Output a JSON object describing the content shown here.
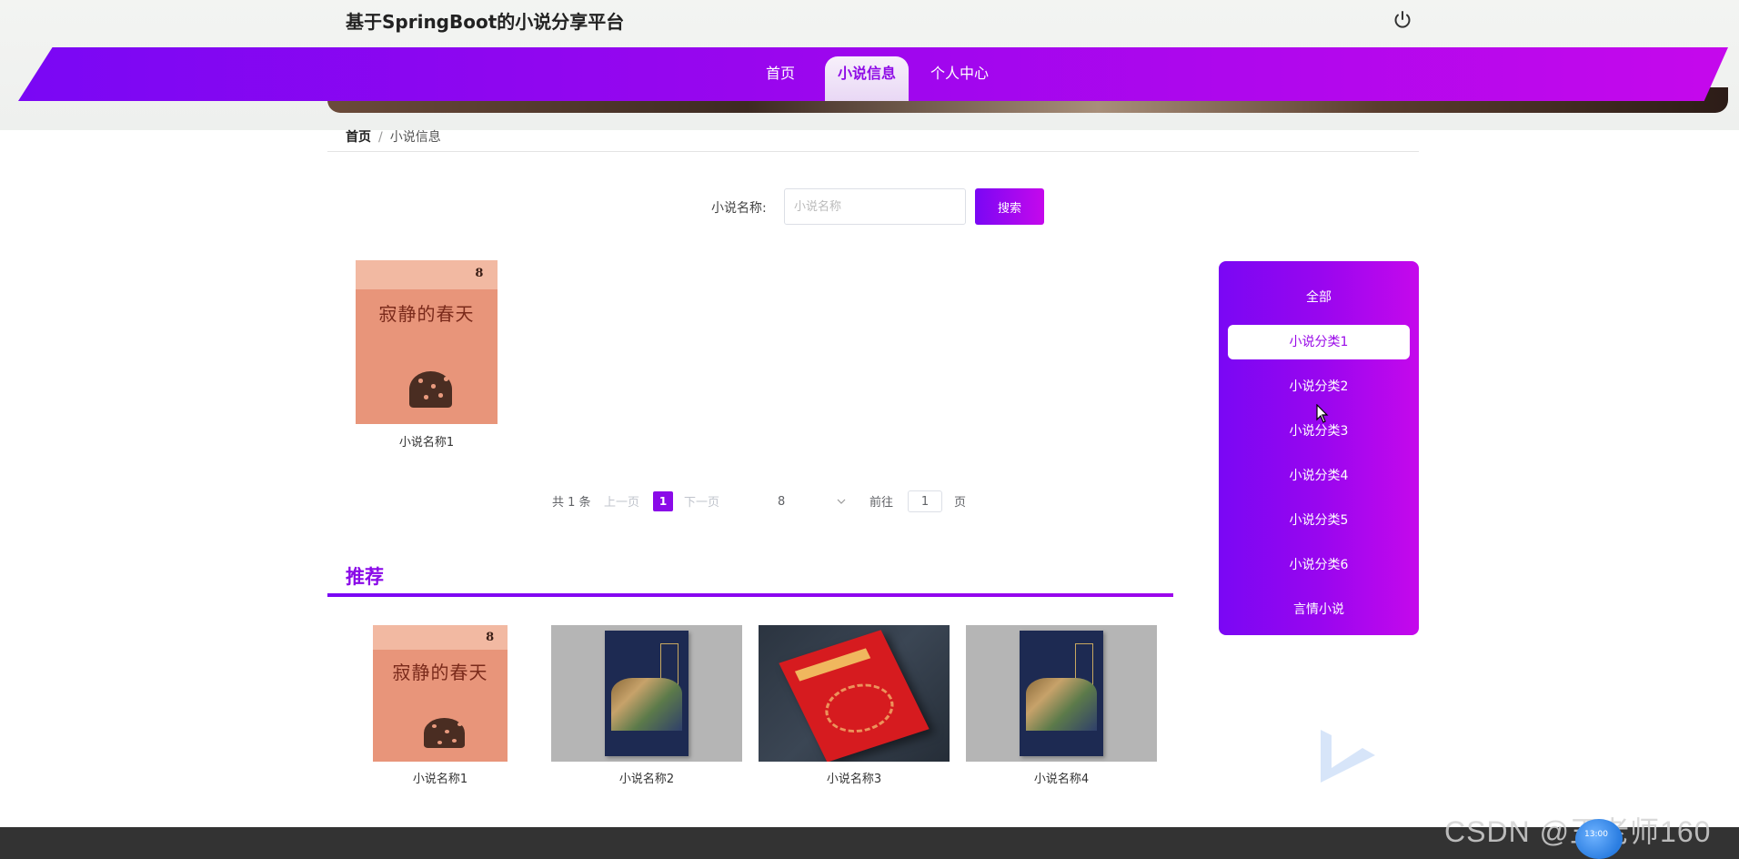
{
  "header": {
    "site_title": "基于SpringBoot的小说分享平台",
    "nav": [
      {
        "label": "首页"
      },
      {
        "label": "小说信息"
      },
      {
        "label": "个人中心"
      }
    ]
  },
  "breadcrumb": {
    "home": "首页",
    "separator": "/",
    "current": "小说信息"
  },
  "search": {
    "label": "小说名称:",
    "placeholder": "小说名称",
    "value": "",
    "button_label": "搜索"
  },
  "novels": [
    {
      "name": "小说名称1",
      "cover_title": "寂静的春天",
      "cover_number": "8"
    }
  ],
  "pagination": {
    "total": "共 1 条",
    "prev": "上一页",
    "current": "1",
    "next": "下一页",
    "page_size": "8",
    "goto_label": "前往",
    "goto_value": "1",
    "page_unit": "页"
  },
  "recommend": {
    "title": "推荐",
    "items": [
      {
        "name": "小说名称1",
        "cover_title": "寂静的春天",
        "cover_number": "8"
      },
      {
        "name": "小说名称2"
      },
      {
        "name": "小说名称3"
      },
      {
        "name": "小说名称4"
      }
    ]
  },
  "categories": {
    "active_index": 1,
    "items": [
      {
        "label": "全部"
      },
      {
        "label": "小说分类1"
      },
      {
        "label": "小说分类2"
      },
      {
        "label": "小说分类3"
      },
      {
        "label": "小说分类4"
      },
      {
        "label": "小说分类5"
      },
      {
        "label": "小说分类6"
      },
      {
        "label": "言情小说"
      }
    ]
  },
  "watermark": {
    "text": "CSDN @王老师160",
    "video_time": "13:00"
  },
  "colors": {
    "accent_start": "#7a07f4",
    "accent_end": "#c508ec",
    "active_text": "#8a0ae8"
  },
  "icons": {
    "power": "power-icon",
    "chevron": "chevron-down-icon",
    "cursor": "mouse-cursor-icon"
  }
}
